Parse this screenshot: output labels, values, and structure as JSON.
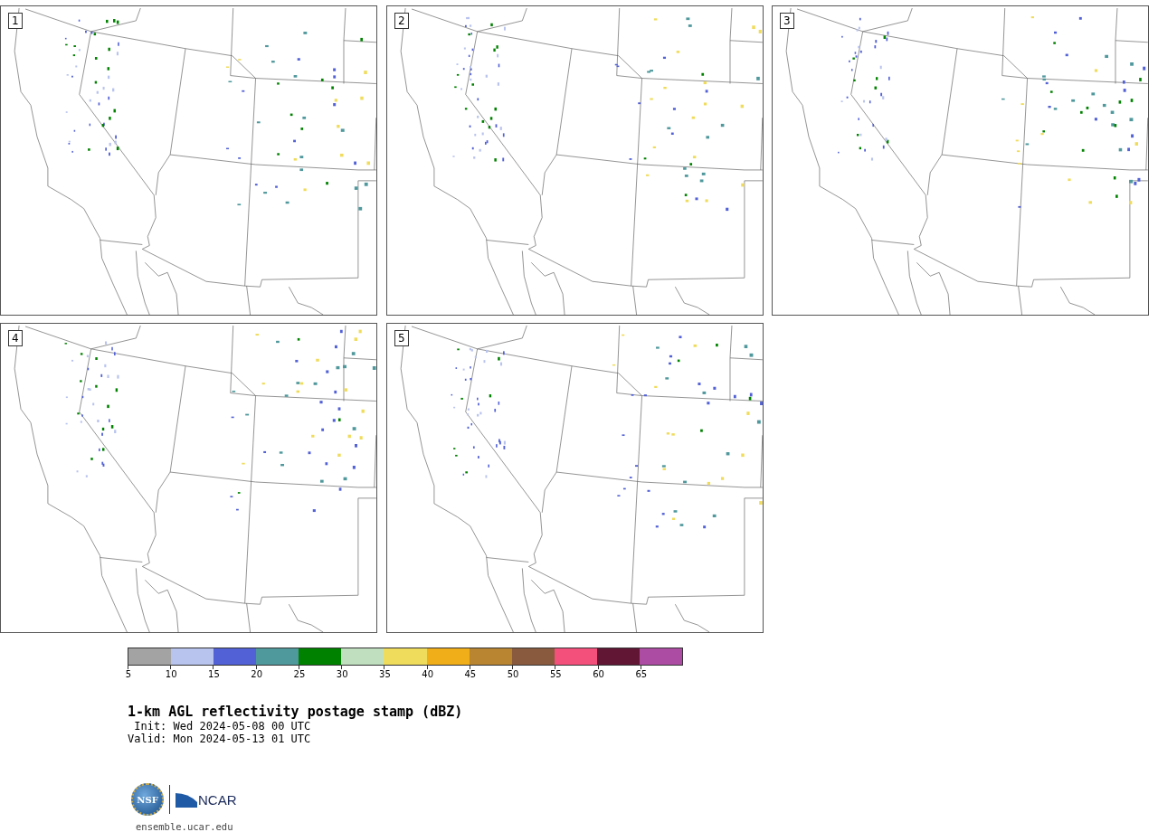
{
  "panels": [
    {
      "label": "1"
    },
    {
      "label": "2"
    },
    {
      "label": "3"
    },
    {
      "label": "4"
    },
    {
      "label": "5"
    }
  ],
  "colorbar": {
    "bins": [
      {
        "color": "#a3a3a3"
      },
      {
        "color": "#b8c3ee"
      },
      {
        "color": "#5261d6"
      },
      {
        "color": "#4f989c"
      },
      {
        "color": "#008200"
      },
      {
        "color": "#bfdfbf"
      },
      {
        "color": "#f0dc5c"
      },
      {
        "color": "#f0ae18"
      },
      {
        "color": "#b98531"
      },
      {
        "color": "#8a5a3e"
      },
      {
        "color": "#f4507c"
      },
      {
        "color": "#611634"
      },
      {
        "color": "#ad4ca3"
      }
    ],
    "ticks": [
      "5",
      "10",
      "15",
      "20",
      "25",
      "30",
      "35",
      "40",
      "45",
      "50",
      "55",
      "60",
      "65"
    ]
  },
  "title": "1-km AGL reflectivity postage stamp (dBZ)",
  "init": " Init: Wed 2024-05-08 00 UTC",
  "valid": "Valid: Mon 2024-05-13 01 UTC",
  "logos": {
    "nsf": "NSF",
    "ncar": "NCAR"
  },
  "footer": "ensemble.ucar.edu"
}
